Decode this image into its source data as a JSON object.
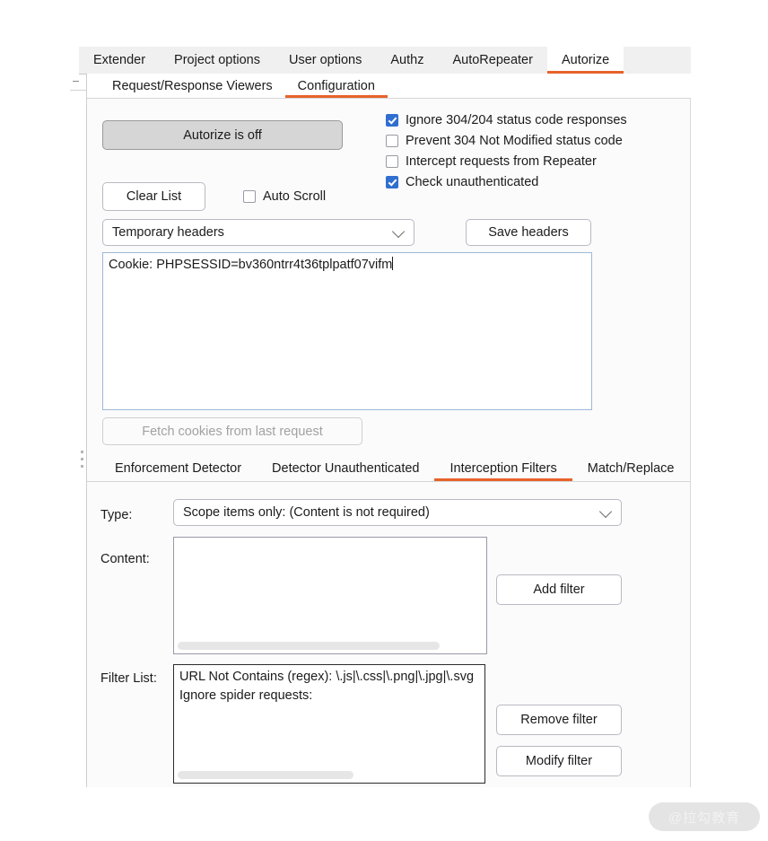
{
  "top_tabs": [
    {
      "label": "Extender",
      "active": false
    },
    {
      "label": "Project options",
      "active": false
    },
    {
      "label": "User options",
      "active": false
    },
    {
      "label": "Authz",
      "active": false
    },
    {
      "label": "AutoRepeater",
      "active": false
    },
    {
      "label": "Autorize",
      "active": true
    }
  ],
  "sub_tabs": [
    {
      "label": "Request/Response Viewers",
      "active": false
    },
    {
      "label": "Configuration",
      "active": true
    }
  ],
  "config": {
    "autorize_toggle_label": "Autorize is off",
    "clear_list_label": "Clear List",
    "auto_scroll_label": "Auto Scroll",
    "auto_scroll_checked": false,
    "options": [
      {
        "label": "Ignore 304/204 status code responses",
        "checked": true
      },
      {
        "label": "Prevent 304 Not Modified status code",
        "checked": false
      },
      {
        "label": "Intercept requests from Repeater",
        "checked": false
      },
      {
        "label": "Check unauthenticated",
        "checked": true
      }
    ],
    "headers_combo_value": "Temporary headers",
    "save_headers_label": "Save headers",
    "headers_text": "Cookie: PHPSESSID=bv360ntrr4t36tplpatf07vifm",
    "fetch_cookies_label": "Fetch cookies from last request"
  },
  "filter_tabs": [
    {
      "label": "Enforcement Detector",
      "active": false
    },
    {
      "label": "Detector Unauthenticated",
      "active": false
    },
    {
      "label": "Interception Filters",
      "active": true
    },
    {
      "label": "Match/Replace",
      "active": false
    }
  ],
  "interception": {
    "type_label": "Type:",
    "type_value": "Scope items only: (Content is not required)",
    "content_label": "Content:",
    "content_value": "",
    "add_filter_label": "Add filter",
    "filter_list_label": "Filter List:",
    "filter_items": [
      "URL Not Contains (regex): \\.js|\\.css|\\.png|\\.jpg|\\.svg",
      "Ignore spider requests:"
    ],
    "remove_filter_label": "Remove filter",
    "modify_filter_label": "Modify filter"
  },
  "watermark": "@拉勾教育",
  "colors": {
    "accent_orange": "#e8622a",
    "checkbox_blue": "#2f6fd0",
    "panel_bg": "#fbfbfb",
    "tabbar_bg": "#f0f0f0"
  }
}
